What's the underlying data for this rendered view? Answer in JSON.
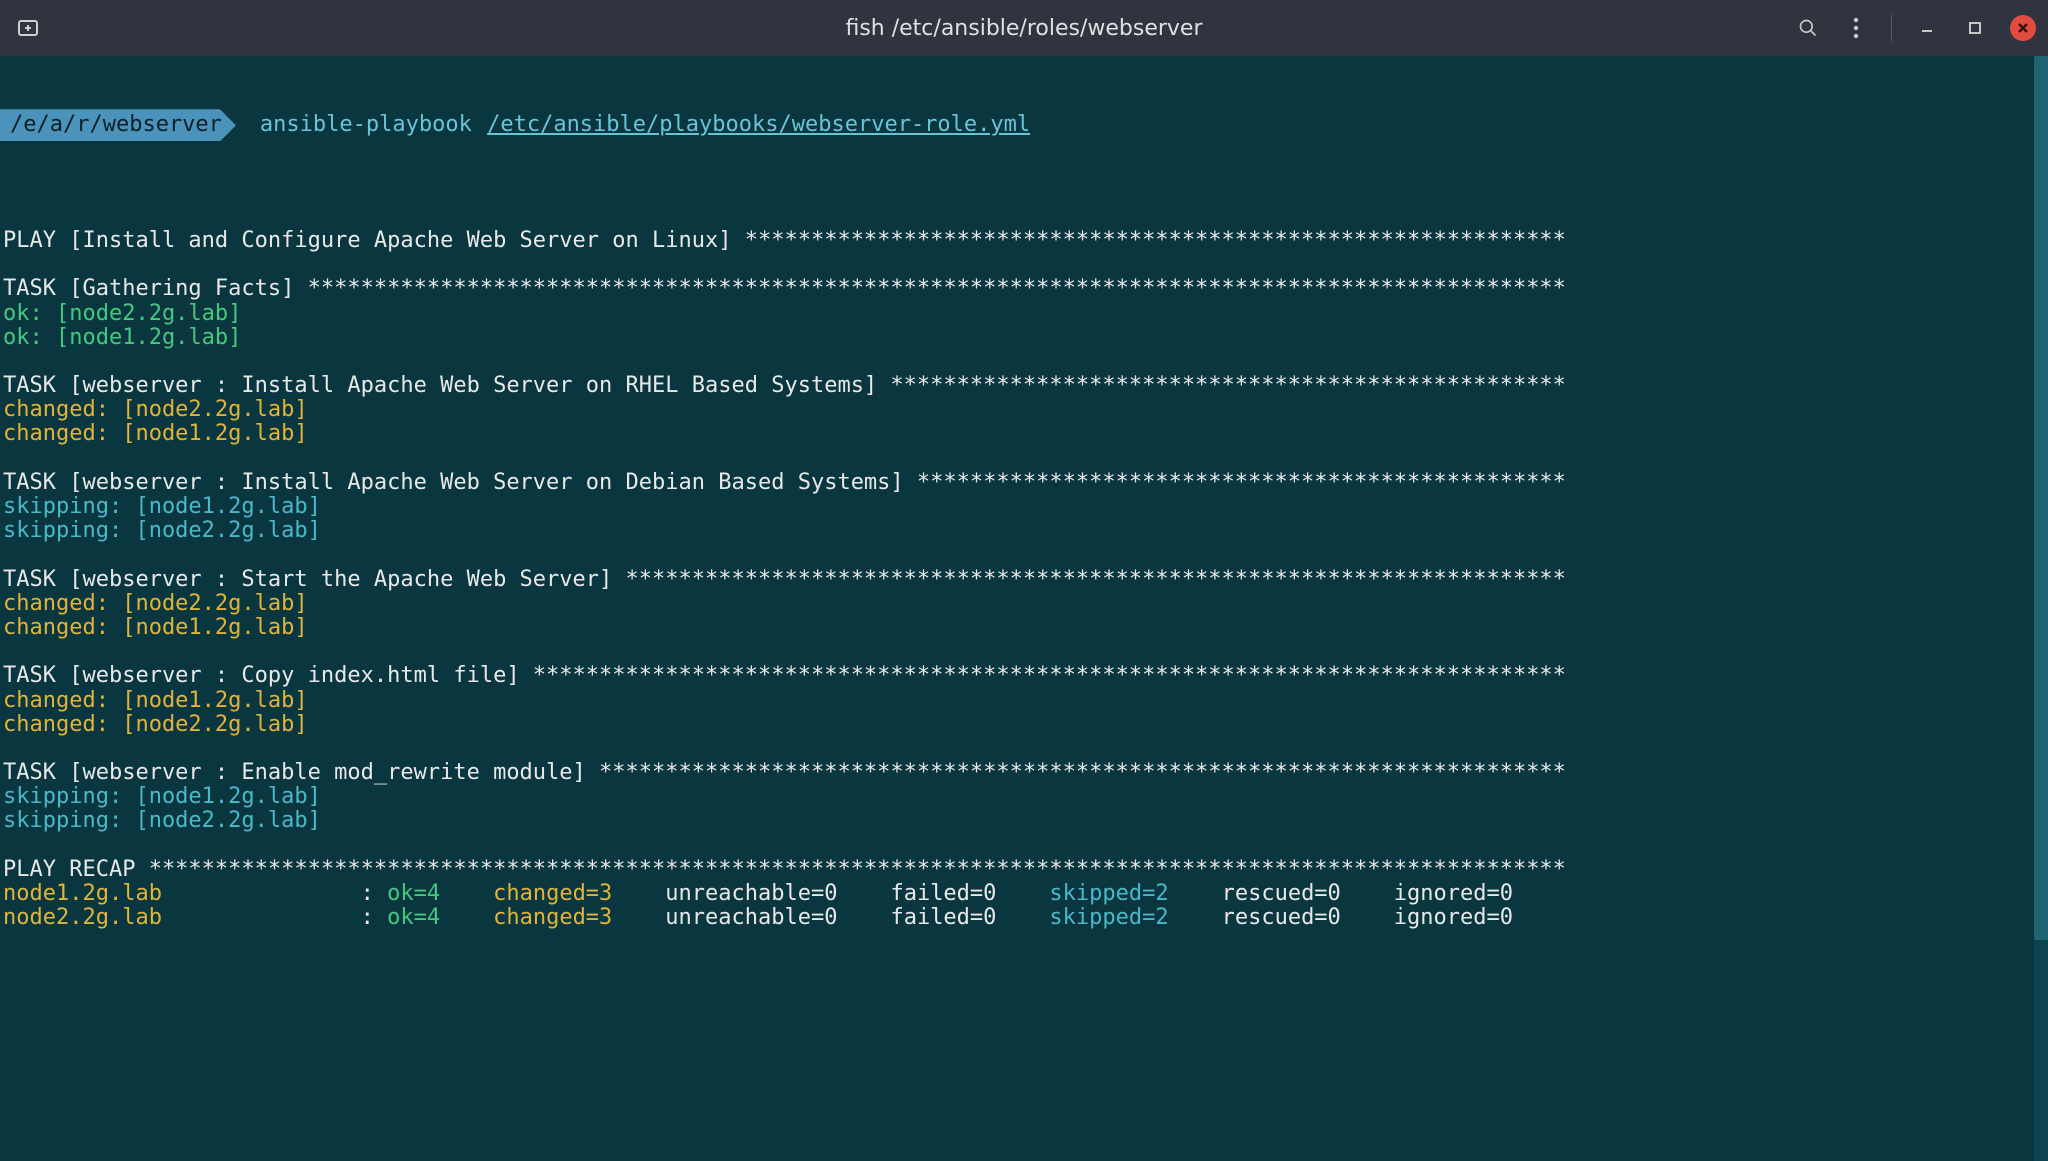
{
  "window": {
    "title": "fish /etc/ansible/roles/webserver"
  },
  "prompt": {
    "cwd": "/e/a/r/webserver",
    "cmd_bin": "ansible-playbook",
    "cmd_arg": "/etc/ansible/playbooks/webserver-role.yml"
  },
  "plays": {
    "play_header": "PLAY [Install and Configure Apache Web Server on Linux] ",
    "recap_header": "PLAY RECAP "
  },
  "tasks": [
    {
      "header": "TASK [Gathering Facts] ",
      "results": [
        {
          "status": "ok",
          "host": "node2.2g.lab"
        },
        {
          "status": "ok",
          "host": "node1.2g.lab"
        }
      ]
    },
    {
      "header": "TASK [webserver : Install Apache Web Server on RHEL Based Systems] ",
      "results": [
        {
          "status": "changed",
          "host": "node2.2g.lab"
        },
        {
          "status": "changed",
          "host": "node1.2g.lab"
        }
      ]
    },
    {
      "header": "TASK [webserver : Install Apache Web Server on Debian Based Systems] ",
      "results": [
        {
          "status": "skipping",
          "host": "node1.2g.lab"
        },
        {
          "status": "skipping",
          "host": "node2.2g.lab"
        }
      ]
    },
    {
      "header": "TASK [webserver : Start the Apache Web Server] ",
      "results": [
        {
          "status": "changed",
          "host": "node2.2g.lab"
        },
        {
          "status": "changed",
          "host": "node1.2g.lab"
        }
      ]
    },
    {
      "header": "TASK [webserver : Copy index.html file] ",
      "results": [
        {
          "status": "changed",
          "host": "node1.2g.lab"
        },
        {
          "status": "changed",
          "host": "node2.2g.lab"
        }
      ]
    },
    {
      "header": "TASK [webserver : Enable mod_rewrite module] ",
      "results": [
        {
          "status": "skipping",
          "host": "node1.2g.lab"
        },
        {
          "status": "skipping",
          "host": "node2.2g.lab"
        }
      ]
    }
  ],
  "recap": [
    {
      "host": "node1.2g.lab",
      "ok": "ok=4",
      "changed": "changed=3",
      "unreachable": "unreachable=0",
      "failed": "failed=0",
      "skipped": "skipped=2",
      "rescued": "rescued=0",
      "ignored": "ignored=0"
    },
    {
      "host": "node2.2g.lab",
      "ok": "ok=4",
      "changed": "changed=3",
      "unreachable": "unreachable=0",
      "failed": "failed=0",
      "skipped": "skipped=2",
      "rescued": "rescued=0",
      "ignored": "ignored=0"
    }
  ],
  "colors": {
    "ok": "#46c97e",
    "changed": "#e0b43a",
    "skipping": "#4bb8c9"
  }
}
